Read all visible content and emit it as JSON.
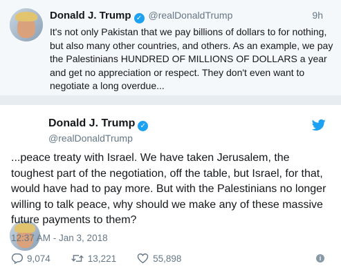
{
  "first_tweet": {
    "author_name": "Donald J. Trump",
    "author_handle": "@realDonaldTrump",
    "time": "9h",
    "text": "It's not only Pakistan that we pay billions of dollars to for nothing, but also many other countries, and others. As an example, we pay the Palestinians HUNDRED OF MILLIONS OF DOLLARS a year and get no appreciation or respect. They don't even want to negotiate a long overdue...",
    "verified_icon": "verified-icon"
  },
  "second_tweet": {
    "author_name": "Donald J. Trump",
    "author_handle": "@realDonaldTrump",
    "text": "...peace treaty with Israel. We have taken Jerusalem, the toughest part of the negotiation, off the table, but Israel, for that, would have had to pay more. But with the Palestinians no longer willing to talk peace, why should we make any of these massive future payments to them?",
    "timestamp": "12:37 AM - Jan 3, 2018",
    "replies": "9,074",
    "retweets": "13,221",
    "likes": "55,898",
    "bird_icon_color": "#1da1f2"
  }
}
